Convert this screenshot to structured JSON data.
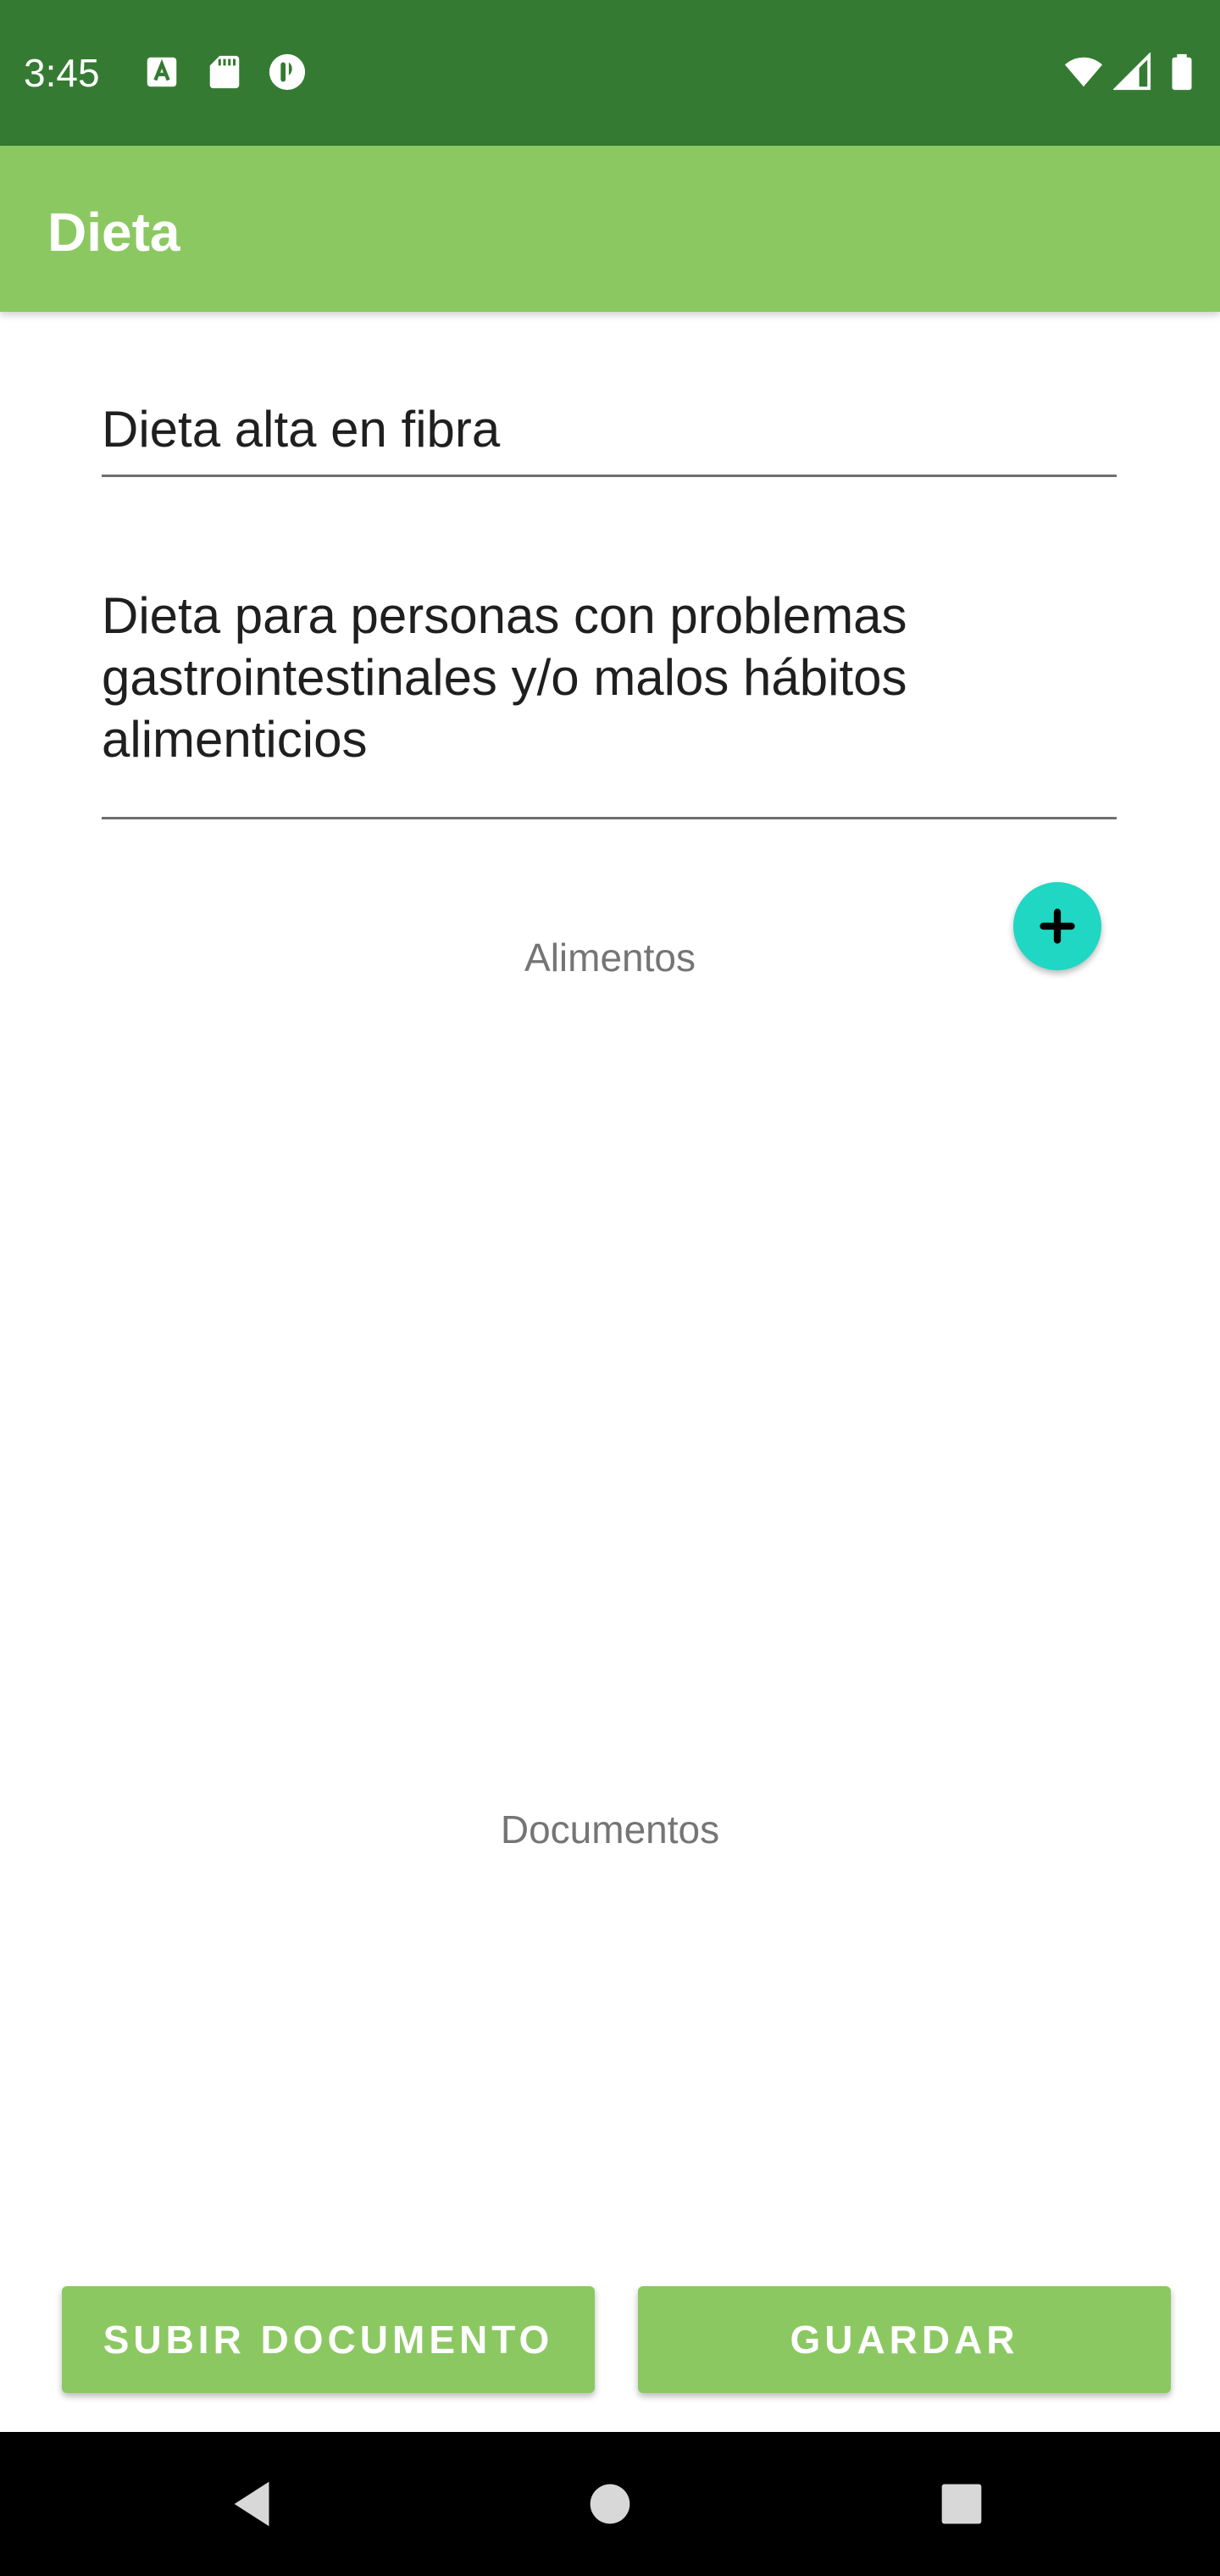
{
  "status_bar": {
    "time": "3:45",
    "left_icons": [
      "keyboard-a-icon",
      "sd-card-icon",
      "pinwheel-app-icon"
    ],
    "right_icons": [
      "wifi-icon",
      "cell-signal-icon",
      "battery-icon"
    ],
    "background": "#357a32"
  },
  "app_bar": {
    "title": "Dieta",
    "background": "#8bc862"
  },
  "form": {
    "name_value": "Dieta alta en fibra",
    "description_value": "Dieta para personas con problemas\ngastrointestinales y/o malos hábitos\nalimenticios"
  },
  "sections": {
    "alimentos_label": "Alimentos",
    "documentos_label": "Documentos"
  },
  "fab": {
    "icon": "plus-icon",
    "color": "#1fd7c3"
  },
  "buttons": {
    "upload_label": "SUBIR DOCUMENTO",
    "save_label": "GUARDAR",
    "color": "#8bc862"
  },
  "nav_bar": {
    "icons": [
      "back-icon",
      "home-icon",
      "recents-icon"
    ]
  }
}
